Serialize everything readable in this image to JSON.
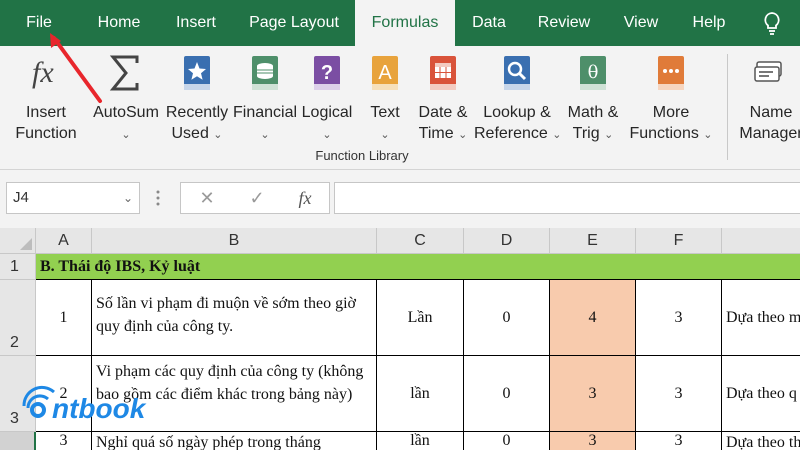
{
  "tabs": [
    "File",
    "Home",
    "Insert",
    "Page Layout",
    "Formulas",
    "Data",
    "Review",
    "View",
    "Help"
  ],
  "ribbon": {
    "buttons": [
      {
        "line1": "Insert",
        "line2": "Function",
        "icon": "fx-icon",
        "caret": ""
      },
      {
        "line1": "AutoSum",
        "line2": "",
        "icon": "sigma-icon",
        "caret": "⌄"
      },
      {
        "line1": "Recently",
        "line2": "Used",
        "icon": "star-book-icon",
        "caret": "⌄"
      },
      {
        "line1": "Financial",
        "line2": "",
        "icon": "coins-book-icon",
        "caret": "⌄"
      },
      {
        "line1": "Logical",
        "line2": "",
        "icon": "question-book-icon",
        "caret": "⌄"
      },
      {
        "line1": "Text",
        "line2": "",
        "icon": "text-book-icon",
        "caret": "⌄"
      },
      {
        "line1": "Date &",
        "line2": "Time",
        "icon": "calendar-book-icon",
        "caret": "⌄"
      },
      {
        "line1": "Lookup &",
        "line2": "Reference",
        "icon": "magnifier-book-icon",
        "caret": "⌄"
      },
      {
        "line1": "Math &",
        "line2": "Trig",
        "icon": "theta-book-icon",
        "caret": "⌄"
      },
      {
        "line1": "More",
        "line2": "Functions",
        "icon": "more-book-icon",
        "caret": "⌄"
      },
      {
        "line1": "Name",
        "line2": "Manager",
        "icon": "tags-icon",
        "caret": ""
      }
    ],
    "group_label": "Function Library"
  },
  "formula_bar": {
    "name_box": "J4",
    "cancel_glyph": "✕",
    "enter_glyph": "✓",
    "fx_glyph": "fx",
    "formula": ""
  },
  "sheet": {
    "columns": [
      "A",
      "B",
      "C",
      "D",
      "E",
      "F"
    ],
    "rows": [
      {
        "num": "1",
        "section": "B. Thái độ IBS, Kỷ luật"
      },
      {
        "num": "2",
        "a": "1",
        "b": "Số lần vi phạm đi muộn về sớm theo giờ quy định của công ty.",
        "c": "Lần",
        "d": "0",
        "e": "4",
        "f": "3",
        "g": "Dựa theo m"
      },
      {
        "num": "3",
        "a": "2",
        "b": "Vi phạm các quy định của công ty (không bao gồm các điểm khác trong bảng này)",
        "c": "lần",
        "d": "0",
        "e": "3",
        "f": "3",
        "g": "Dựa theo q"
      },
      {
        "num": "",
        "a": "3",
        "b": "Nghỉ quá số ngày phép trong tháng",
        "c": "lần",
        "d": "0",
        "e": "3",
        "f": "3",
        "g": "Dựa theo th"
      }
    ]
  },
  "watermark": {
    "text": "ntbook"
  },
  "colors": {
    "accent": "#217346",
    "highlight": "#f8cbad",
    "section": "#92d050",
    "arrow": "#e8262c"
  }
}
